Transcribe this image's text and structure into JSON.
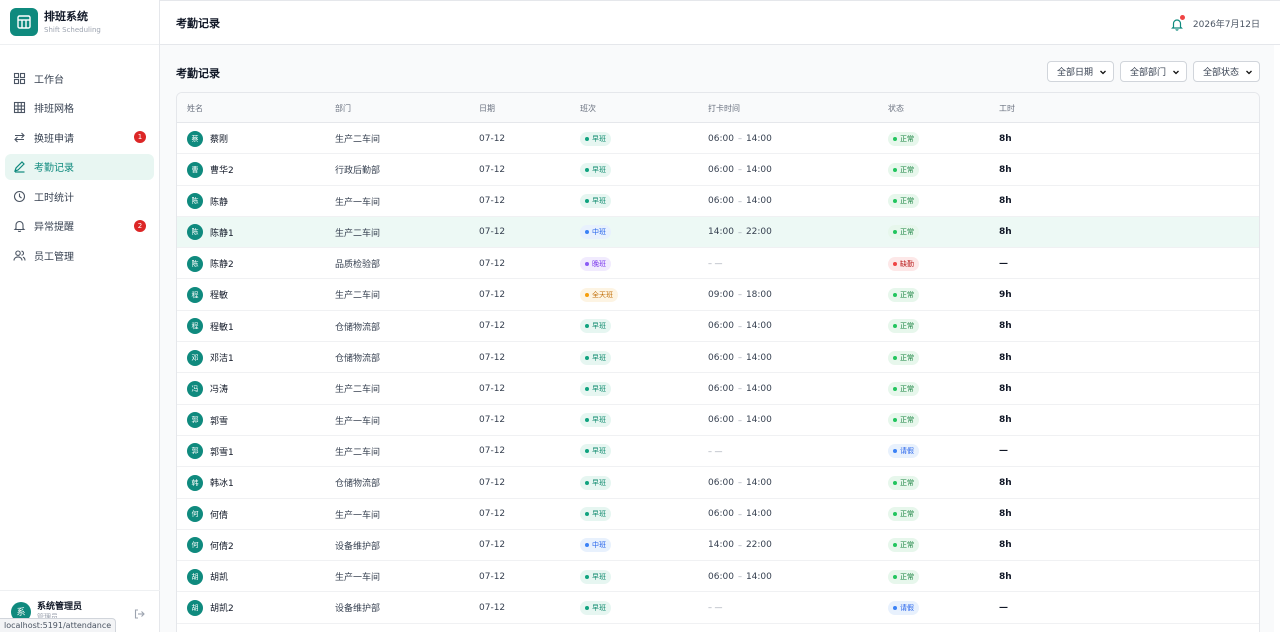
{
  "brand": {
    "title": "排班系统",
    "subtitle": "Shift Scheduling"
  },
  "nav": [
    {
      "label": "工作台",
      "icon": "dashboard-grid-icon",
      "active": false,
      "badge": ""
    },
    {
      "label": "排班网格",
      "icon": "table-grid-icon",
      "active": false,
      "badge": ""
    },
    {
      "label": "换班申请",
      "icon": "swap-arrows-icon",
      "active": false,
      "badge": "1"
    },
    {
      "label": "考勤记录",
      "icon": "pencil-icon",
      "active": true,
      "badge": ""
    },
    {
      "label": "工时统计",
      "icon": "clock-icon",
      "active": false,
      "badge": ""
    },
    {
      "label": "异常提醒",
      "icon": "bell-icon",
      "active": false,
      "badge": "2"
    },
    {
      "label": "员工管理",
      "icon": "users-icon",
      "active": false,
      "badge": ""
    }
  ],
  "user": {
    "avatar": "系",
    "name": "系统管理员",
    "role": "管理员"
  },
  "url_tooltip": "localhost:5191/attendance",
  "header": {
    "title": "考勤记录",
    "date": "2026年7月12日"
  },
  "section_title": "考勤记录",
  "filters": {
    "date": "全部日期",
    "department": "全部部门",
    "status": "全部状态"
  },
  "columns": {
    "name": "姓名",
    "dept": "部门",
    "date": "日期",
    "shift": "班次",
    "clock": "打卡时间",
    "status": "状态",
    "hours": "工时"
  },
  "shift_colors": {
    "早班": {
      "bg": "#e6f6f1",
      "fg": "#0f8a6e",
      "dot": "#10a37f"
    },
    "中班": {
      "bg": "#e8f1fd",
      "fg": "#2563eb",
      "dot": "#3b82f6"
    },
    "晚班": {
      "bg": "#f1ebfe",
      "fg": "#7c3aed",
      "dot": "#8b5cf6"
    },
    "全天班": {
      "bg": "#fdf4e3",
      "fg": "#c2710c",
      "dot": "#f59e0b"
    }
  },
  "status_colors": {
    "正常": {
      "bg": "#e7f7ec",
      "fg": "#15803d",
      "dot": "#22c55e"
    },
    "缺勤": {
      "bg": "#fde8e8",
      "fg": "#b91c1c",
      "dot": "#ef4444"
    },
    "请假": {
      "bg": "#e8f1fd",
      "fg": "#2563eb",
      "dot": "#3b82f6"
    }
  },
  "rows": [
    {
      "avatar": "蔡",
      "name": "蔡刚",
      "dept": "生产二车间",
      "date": "07-12",
      "shift": "早班",
      "in": "06:00",
      "out": "14:00",
      "status": "正常",
      "hours": "8h",
      "highlight": false
    },
    {
      "avatar": "曹",
      "name": "曹华2",
      "dept": "行政后勤部",
      "date": "07-12",
      "shift": "早班",
      "in": "06:00",
      "out": "14:00",
      "status": "正常",
      "hours": "8h",
      "highlight": false
    },
    {
      "avatar": "陈",
      "name": "陈静",
      "dept": "生产一车间",
      "date": "07-12",
      "shift": "早班",
      "in": "06:00",
      "out": "14:00",
      "status": "正常",
      "hours": "8h",
      "highlight": false
    },
    {
      "avatar": "陈",
      "name": "陈静1",
      "dept": "生产二车间",
      "date": "07-12",
      "shift": "中班",
      "in": "14:00",
      "out": "22:00",
      "status": "正常",
      "hours": "8h",
      "highlight": true
    },
    {
      "avatar": "陈",
      "name": "陈静2",
      "dept": "品质检验部",
      "date": "07-12",
      "shift": "晚班",
      "in": "",
      "out": "",
      "status": "缺勤",
      "hours": "—",
      "highlight": false
    },
    {
      "avatar": "程",
      "name": "程敏",
      "dept": "生产二车间",
      "date": "07-12",
      "shift": "全天班",
      "in": "09:00",
      "out": "18:00",
      "status": "正常",
      "hours": "9h",
      "highlight": false
    },
    {
      "avatar": "程",
      "name": "程敏1",
      "dept": "仓储物流部",
      "date": "07-12",
      "shift": "早班",
      "in": "06:00",
      "out": "14:00",
      "status": "正常",
      "hours": "8h",
      "highlight": false
    },
    {
      "avatar": "邓",
      "name": "邓洁1",
      "dept": "仓储物流部",
      "date": "07-12",
      "shift": "早班",
      "in": "06:00",
      "out": "14:00",
      "status": "正常",
      "hours": "8h",
      "highlight": false
    },
    {
      "avatar": "冯",
      "name": "冯涛",
      "dept": "生产二车间",
      "date": "07-12",
      "shift": "早班",
      "in": "06:00",
      "out": "14:00",
      "status": "正常",
      "hours": "8h",
      "highlight": false
    },
    {
      "avatar": "郭",
      "name": "郭雪",
      "dept": "生产一车间",
      "date": "07-12",
      "shift": "早班",
      "in": "06:00",
      "out": "14:00",
      "status": "正常",
      "hours": "8h",
      "highlight": false
    },
    {
      "avatar": "郭",
      "name": "郭雪1",
      "dept": "生产二车间",
      "date": "07-12",
      "shift": "早班",
      "in": "",
      "out": "",
      "status": "请假",
      "hours": "—",
      "highlight": false
    },
    {
      "avatar": "韩",
      "name": "韩冰1",
      "dept": "仓储物流部",
      "date": "07-12",
      "shift": "早班",
      "in": "06:00",
      "out": "14:00",
      "status": "正常",
      "hours": "8h",
      "highlight": false
    },
    {
      "avatar": "何",
      "name": "何倩",
      "dept": "生产一车间",
      "date": "07-12",
      "shift": "早班",
      "in": "06:00",
      "out": "14:00",
      "status": "正常",
      "hours": "8h",
      "highlight": false
    },
    {
      "avatar": "何",
      "name": "何倩2",
      "dept": "设备维护部",
      "date": "07-12",
      "shift": "中班",
      "in": "14:00",
      "out": "22:00",
      "status": "正常",
      "hours": "8h",
      "highlight": false
    },
    {
      "avatar": "胡",
      "name": "胡凯",
      "dept": "生产一车间",
      "date": "07-12",
      "shift": "早班",
      "in": "06:00",
      "out": "14:00",
      "status": "正常",
      "hours": "8h",
      "highlight": false
    },
    {
      "avatar": "胡",
      "name": "胡凯2",
      "dept": "设备维护部",
      "date": "07-12",
      "shift": "早班",
      "in": "",
      "out": "",
      "status": "请假",
      "hours": "—",
      "highlight": false
    }
  ]
}
